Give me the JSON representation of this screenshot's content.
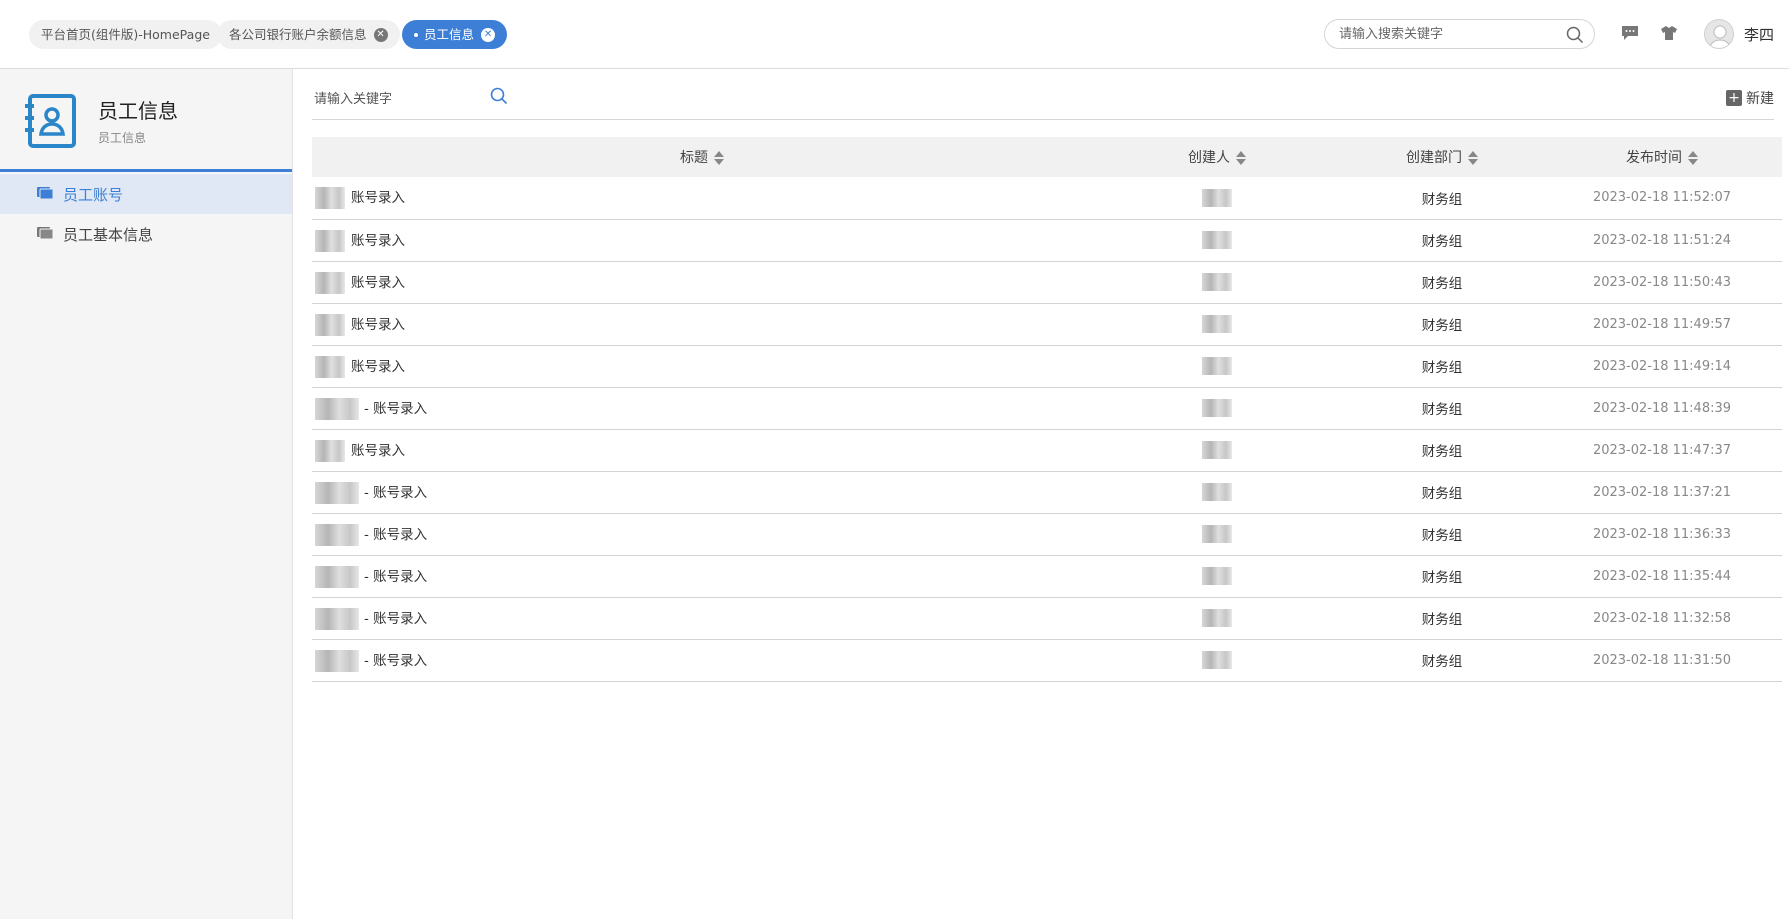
{
  "topbar": {
    "tabs": [
      {
        "label": "平台首页(组件版)-HomePage",
        "closable": false,
        "active": false
      },
      {
        "label": "各公司银行账户余额信息",
        "closable": true,
        "active": false
      },
      {
        "label": "员工信息",
        "closable": true,
        "active": true
      }
    ],
    "search_placeholder": "请输入搜索关键字",
    "username": "李四",
    "accent_color": "#3d7fd6"
  },
  "sidebar": {
    "title": "员工信息",
    "subtitle": "员工信息",
    "items": [
      {
        "label": "员工账号",
        "active": true
      },
      {
        "label": "员工基本信息",
        "active": false
      }
    ]
  },
  "main": {
    "search_placeholder": "请输入关键字",
    "new_label": "新建",
    "columns": [
      "标题",
      "创建人",
      "创建部门",
      "发布时间"
    ],
    "rows": [
      {
        "title": "账号录入",
        "dept": "财务组",
        "time": "2023-02-18 11:52:07"
      },
      {
        "title": "账号录入",
        "dept": "财务组",
        "time": "2023-02-18 11:51:24"
      },
      {
        "title": "账号录入",
        "dept": "财务组",
        "time": "2023-02-18 11:50:43"
      },
      {
        "title": "账号录入",
        "dept": "财务组",
        "time": "2023-02-18 11:49:57"
      },
      {
        "title": "账号录入",
        "dept": "财务组",
        "time": "2023-02-18 11:49:14"
      },
      {
        "title": "- 账号录入",
        "dept": "财务组",
        "time": "2023-02-18 11:48:39"
      },
      {
        "title": "账号录入",
        "dept": "财务组",
        "time": "2023-02-18 11:47:37"
      },
      {
        "title": "- 账号录入",
        "dept": "财务组",
        "time": "2023-02-18 11:37:21"
      },
      {
        "title": "- 账号录入",
        "dept": "财务组",
        "time": "2023-02-18 11:36:33"
      },
      {
        "title": "- 账号录入",
        "dept": "财务组",
        "time": "2023-02-18 11:35:44"
      },
      {
        "title": "- 账号录入",
        "dept": "财务组",
        "time": "2023-02-18 11:32:58"
      },
      {
        "title": "- 账号录入",
        "dept": "财务组",
        "time": "2023-02-18 11:31:50"
      }
    ]
  }
}
